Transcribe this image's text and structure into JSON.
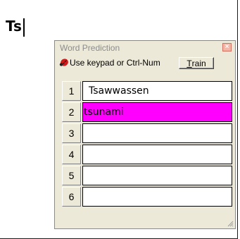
{
  "document": {
    "typed_text": "Ts"
  },
  "word_prediction": {
    "title": "Word Prediction",
    "close_label": "×",
    "hint": "Use keypad or Ctrl-Num",
    "train_underlined": "T",
    "train_rest": "rain",
    "selected_index": 2,
    "colors": {
      "selected": "#ff00ff",
      "panel": "#ece9d8"
    },
    "icons": {
      "hint": "ladybug-icon",
      "close": "close-icon",
      "resize": "resize-grip-icon"
    },
    "items": [
      {
        "num": "1",
        "word": "Tsawwassen"
      },
      {
        "num": "2",
        "word": "tsunami"
      },
      {
        "num": "3",
        "word": ""
      },
      {
        "num": "4",
        "word": ""
      },
      {
        "num": "5",
        "word": ""
      },
      {
        "num": "6",
        "word": ""
      }
    ]
  }
}
